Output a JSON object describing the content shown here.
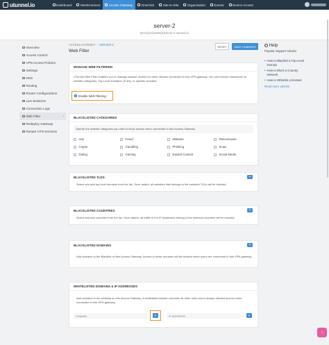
{
  "brand": {
    "name": "utunnel.io",
    "accent": "#3f8fd8",
    "nav_bg": "#263746",
    "highlight": "#e8912e"
  },
  "nav": [
    {
      "label": "Dashboard",
      "icon": "dashboard-icon",
      "active": false
    },
    {
      "label": "MeshConnect",
      "icon": "mesh-icon",
      "active": false
    },
    {
      "label": "Access Gateway",
      "icon": "gateway-icon",
      "active": true
    },
    {
      "label": "OneClick",
      "icon": "oneclick-icon",
      "active": false
    },
    {
      "label": "Site-to-Site",
      "icon": "site-icon",
      "active": false
    },
    {
      "label": "Organization",
      "icon": "org-icon",
      "active": false
    },
    {
      "label": "Events",
      "icon": "events-icon",
      "active": false
    },
    {
      "label": "Device Access",
      "icon": "device-icon",
      "active": false
    }
  ],
  "server": {
    "name": "server-2",
    "host": "dev1(1)ctca404(4)server-2.utunnel.io"
  },
  "sidebar": [
    {
      "label": "Overview",
      "icon": "overview-icon"
    },
    {
      "label": "Access Control",
      "icon": "lock-icon"
    },
    {
      "label": "VPN Access Policies",
      "icon": "policy-icon"
    },
    {
      "label": "Settings",
      "icon": "gear-icon"
    },
    {
      "label": "DNS",
      "icon": "dns-icon"
    },
    {
      "label": "Routing",
      "icon": "routing-icon"
    },
    {
      "label": "Router Configurations",
      "icon": "wrench-icon"
    },
    {
      "label": "Live Sessions",
      "icon": "sessions-icon"
    },
    {
      "label": "Connection Logs",
      "icon": "logs-icon"
    },
    {
      "label": "Web Filter",
      "icon": "filter-icon",
      "active": true
    },
    {
      "label": "Redeploy Gateway",
      "icon": "redeploy-icon"
    },
    {
      "label": "Restart UTN Services",
      "icon": "restart-icon"
    }
  ],
  "breadcrumb": {
    "first": "ACCESS GATEWAY",
    "sep": "›",
    "second": "SERVER-2"
  },
  "page_title": "Web Filter",
  "buttons": {
    "reset": "RESET",
    "save": "SAVE CHANGES"
  },
  "manage": {
    "title": "MANAGE WEB FILTERING",
    "desc": "UTunnel Web Filter enables you to manage website access for client devices connected to this VPN gateway. You can enforce restrictions on website categories, Top-Level Domains (TLDs), or specific domains.",
    "toggle_label": "Enable Web Filtering"
  },
  "categories": {
    "title": "BLACKLISTED CATEGORIES",
    "desc": "Specify the website categories you wish to block access when connected to this Access Gateway.",
    "items": [
      "Ads",
      "Fraud",
      "Malware",
      "Ransomware",
      "Crypto",
      "Gambling",
      "Phishing",
      "Scam",
      "Dating",
      "Gaming",
      "Explicit Content",
      "Social Media"
    ]
  },
  "tlds": {
    "title": "BLACKLISTED TLDS",
    "desc": "Select and add top level domains from the list. Once added, all websites that belongs to the selected TLDs will be blocked."
  },
  "countries": {
    "title": "BLACKLISTED COUNTRIES",
    "desc": "Select and add countries from the list. Once added, all traffic to the IP Addresses belong to the selected countries will be blocked."
  },
  "domains": {
    "title": "BLACKLISTED DOMAINS",
    "desc": "Add domains to the Blacklist on this Access Gateway. Access to these domains will be blocked when users are connected to this VPN gateway."
  },
  "whitelist": {
    "title": "WHITELISTED DOMAINS & IP ADDRESSES",
    "desc": "Add domains to the whitelist on this Access Gateway. A whitelisted domain overrides all other rules and is always allowed access when connected to this VPN gateway.",
    "domain_placeholder": "DOMAIN",
    "ip_placeholder": "IP ADDRESS"
  },
  "help": {
    "title": "Help",
    "subtitle": "Popular Support Articles",
    "articles": [
      "How to Blacklist a Top-Level Domain",
      "How to Block a Country Network",
      "How to Whitelist a Domain"
    ],
    "more": "Read more articles"
  },
  "plus": "+"
}
